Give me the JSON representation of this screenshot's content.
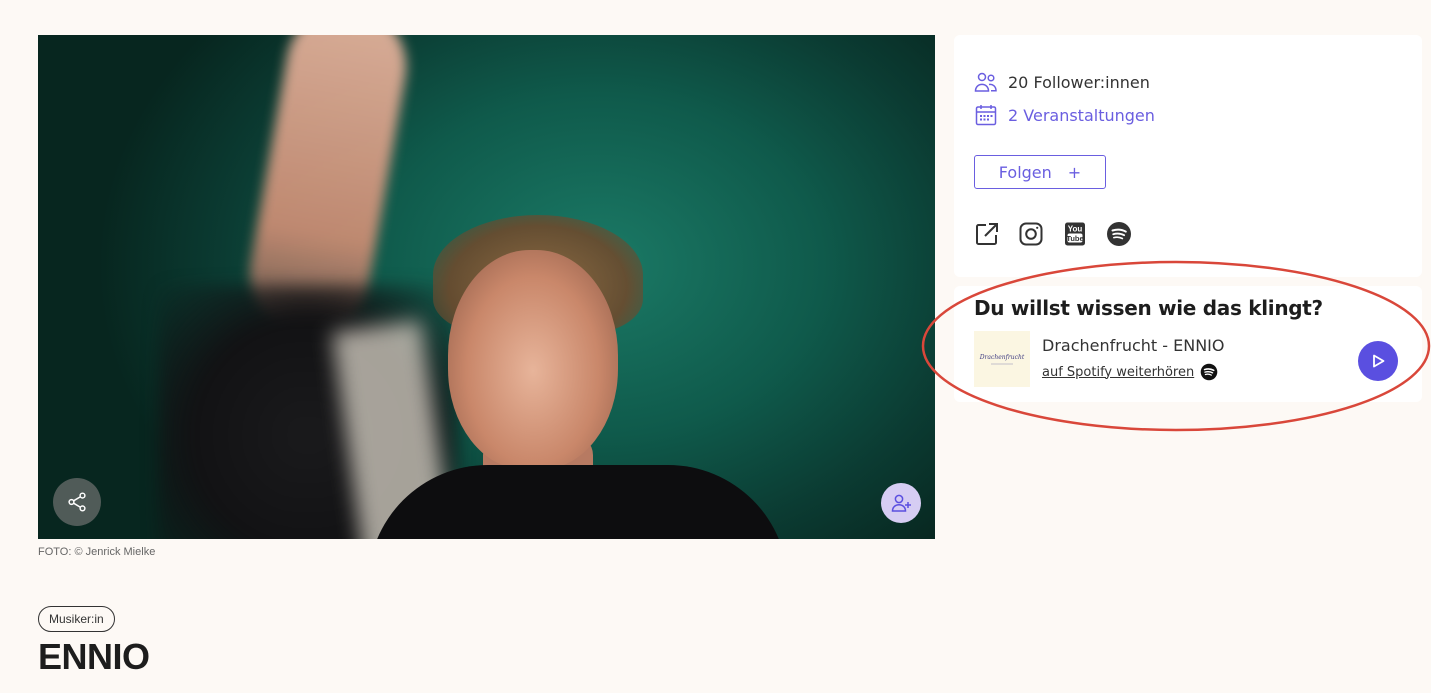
{
  "hero": {
    "photo_alt": "ENNIO",
    "photo_credit": "FOTO: © Jenrick Mielke"
  },
  "artist": {
    "category": "Musiker:in",
    "name": "ENNIO"
  },
  "stats": {
    "followers": "20 Follower:innen",
    "events": "2 Veranstaltungen"
  },
  "follow_button": {
    "label": "Folgen",
    "plus": "+"
  },
  "social_icons": [
    "external-link-icon",
    "instagram-icon",
    "youtube-icon",
    "spotify-icon"
  ],
  "sound": {
    "heading": "Du willst wissen wie das klingt?",
    "track_title": "Drachenfrucht - ENNIO",
    "spotify_link": "auf Spotify weiterhören",
    "cover_text": "Drachenfrucht"
  },
  "colors": {
    "accent": "#6a5ee0",
    "play": "#5a4fe0",
    "annotation": "#d9473a",
    "background": "#fdf9f5"
  }
}
